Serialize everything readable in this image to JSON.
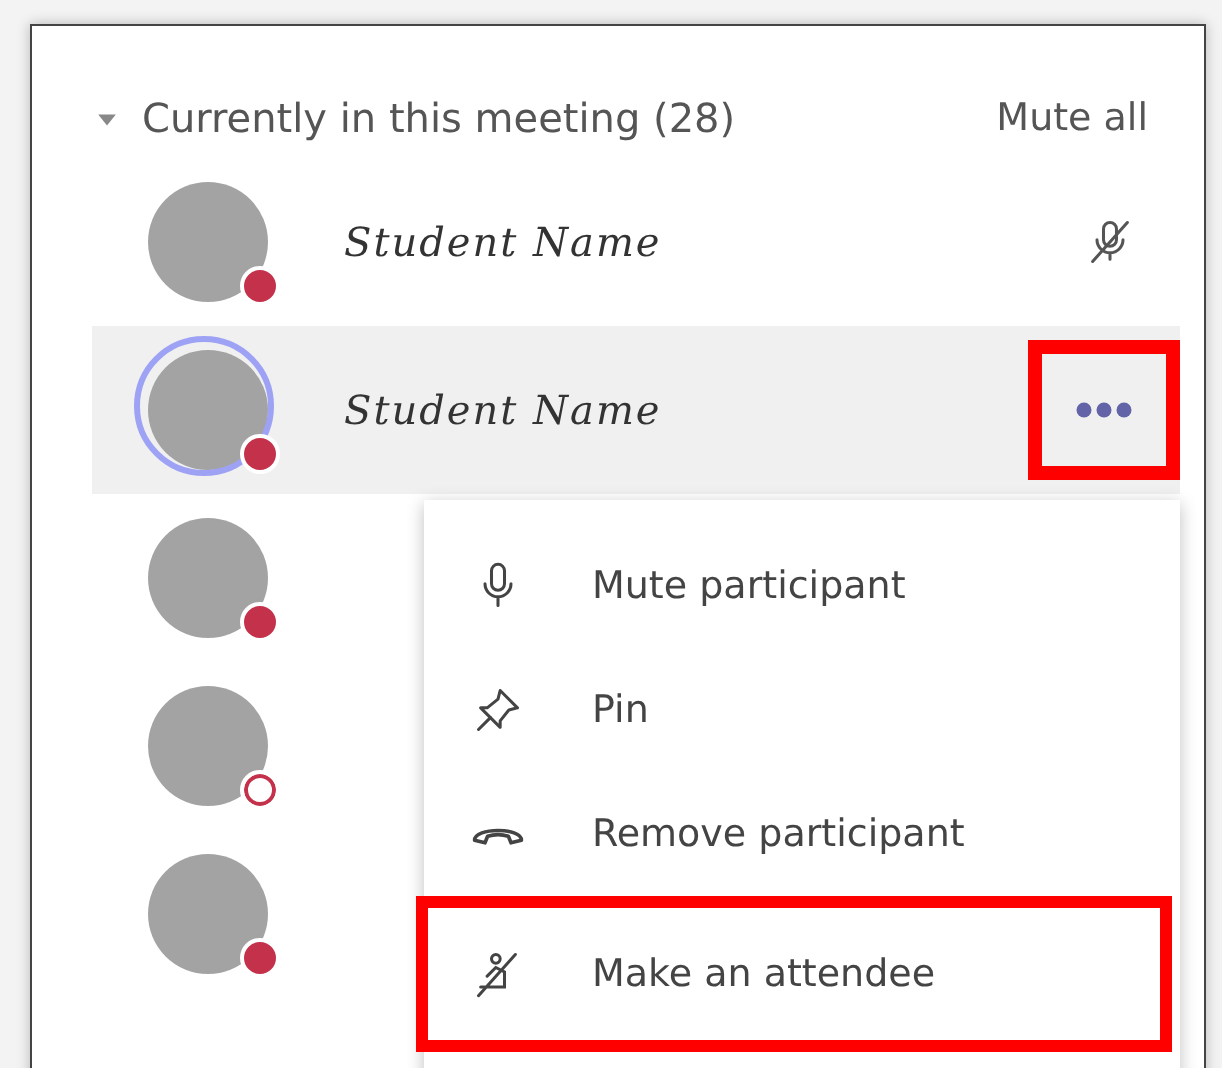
{
  "section": {
    "title": "Currently in this meeting (28)",
    "expanded": true,
    "action": "Mute all"
  },
  "participants": [
    {
      "name": "Student Name",
      "presence_outline": false,
      "muted": true,
      "speaking": false,
      "selected": false
    },
    {
      "name": "Student Name",
      "presence_outline": false,
      "muted": false,
      "speaking": true,
      "selected": true,
      "more_highlighted": true
    },
    {
      "presence_outline": false,
      "muted": false,
      "speaking": false,
      "selected": false
    },
    {
      "presence_outline": true,
      "muted": false,
      "speaking": false,
      "selected": false
    },
    {
      "presence_outline": false,
      "muted": false,
      "speaking": false,
      "selected": false
    }
  ],
  "context_menu": {
    "items": [
      {
        "kind": "mic",
        "label": "Mute participant",
        "highlighted": false
      },
      {
        "kind": "pin",
        "label": "Pin",
        "highlighted": false
      },
      {
        "kind": "hangup",
        "label": "Remove participant",
        "highlighted": false
      },
      {
        "kind": "attendee",
        "label": "Make an attendee",
        "highlighted": true
      }
    ]
  }
}
